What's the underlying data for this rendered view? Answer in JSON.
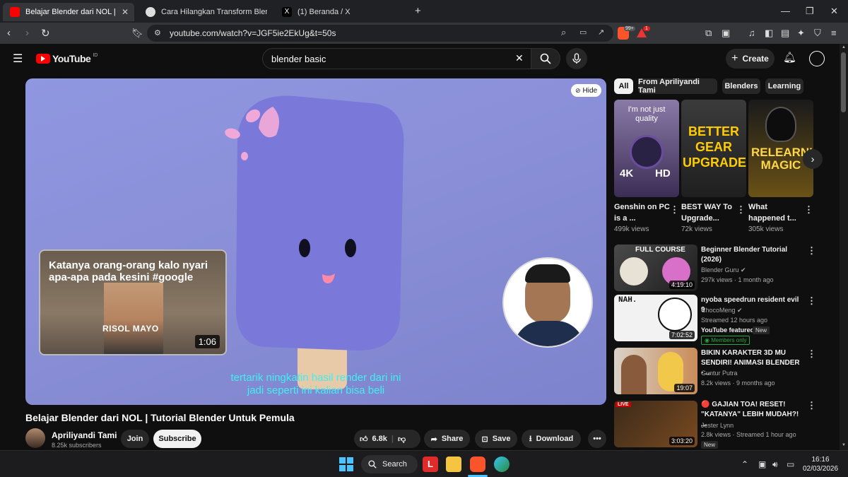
{
  "browser": {
    "tabs": [
      {
        "title": "Belajar Blender dari NOL | Tutorial Blender Untuk Pemula - YouTube",
        "favicon": "youtube-icon",
        "active": true
      },
      {
        "title": "Cara Hilangkan Transform Blender",
        "favicon": "chatgpt-icon",
        "active": false
      },
      {
        "title": "(1) Beranda / X",
        "favicon": "x-icon",
        "active": false
      }
    ],
    "new_tab": "+",
    "url": "youtube.com/watch?v=JGF5ie2EkUg&t=50s",
    "brave_badge": "99+",
    "alert_badge": "1"
  },
  "youtube": {
    "logo_text": "YouTube",
    "region": "ID",
    "search_query": "blender basic",
    "create_label": "Create"
  },
  "player": {
    "hide_label": "Hide",
    "suggestion_title": "Katanya orang-orang kalo nyari apa-apa pada kesini #google",
    "suggestion_caption": "RISOL MAYO",
    "suggestion_duration": "1:06",
    "subtitle_line1": "tertarik ningkatin hasil render dari ini",
    "subtitle_line2": "jadi seperti ini kalian bisa beli"
  },
  "video": {
    "title": "Belajar Blender dari NOL | Tutorial Blender Untuk Pemula",
    "channel": "Apriliyandi Tami",
    "subscribers": "8.25k subscribers",
    "join": "Join",
    "subscribe": "Subscribe",
    "likes": "6.8k",
    "share": "Share",
    "save": "Save",
    "download": "Download"
  },
  "chips": [
    "All",
    "From Apriliyandi Tami",
    "Blenders",
    "Learning"
  ],
  "shorts": [
    {
      "title": "Genshin on PC is a ...",
      "views": "499k views",
      "thumb_text": "I'm not just quality",
      "corner_left": "4K",
      "corner_right": "HD",
      "color": "#6b5a8c"
    },
    {
      "title": "BEST WAY To Upgrade...",
      "views": "72k views",
      "thumb_text": "BETTER GEAR UPGRADE",
      "color": "#2a2a2a"
    },
    {
      "title": "What happened t...",
      "views": "305k views",
      "thumb_text": "RELEARNING MAGIC",
      "color": "#3a2f12"
    }
  ],
  "videos": [
    {
      "title": "Beginner Blender Tutorial (2026)",
      "channel": "Blender Guru",
      "verified": true,
      "meta": "297k views · 1 month ago",
      "duration": "4:19:10",
      "thumb_text": "FULL COURSE"
    },
    {
      "title": "nyoba speedrun resident evil 9",
      "channel": "ChocoMeng",
      "verified": true,
      "meta": "Streamed 12 hours ago",
      "duration": "7:02:52",
      "thumb_text": "NAH.",
      "featured": "YouTube featured",
      "new": "New",
      "members": "Members only"
    },
    {
      "title": "BIKIN KARAKTER 3D MU SENDIRI! ANIMASI BLENDER - ...",
      "channel": "Guntur Putra",
      "meta": "8.2k views · 9 months ago",
      "duration": "19:07"
    },
    {
      "title": "🔴 GAJIAN TOA! RESET! \"KATANYA\" LEBIH MUDAH?! ...",
      "channel": "Jester Lynn",
      "meta": "2.8k views · Streamed 1 hour ago",
      "duration": "3:03:20",
      "thumb_text": "LIVE",
      "new": "New"
    }
  ],
  "taskbar": {
    "search_label": "Search",
    "time": "16:16",
    "date": "02/03/2026"
  },
  "colors": {
    "accent": "#ff0000",
    "subtitle": "#3df0f0",
    "player_bg": "#8b90d8"
  }
}
